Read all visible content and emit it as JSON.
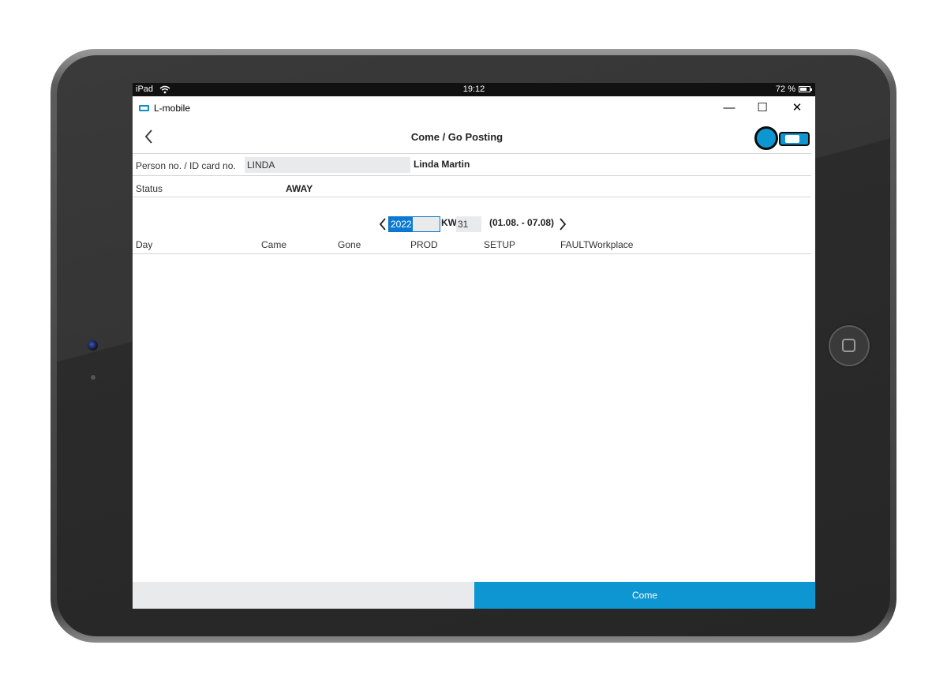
{
  "statusbar": {
    "carrier": "iPad",
    "time": "19:12",
    "battery": "72 %"
  },
  "app": {
    "title": "L-mobile"
  },
  "window_controls": {
    "minimize": "—",
    "maximize": "☐",
    "close": "✕"
  },
  "header": {
    "title": "Come / Go Posting"
  },
  "person": {
    "label": "Person no. / ID card no.",
    "value": "LINDA",
    "name": "Linda Martin"
  },
  "status": {
    "label": "Status",
    "value": "AWAY"
  },
  "week": {
    "year": "2022",
    "kw_label": "KW",
    "kw": "31",
    "range": "(01.08. - 07.08)"
  },
  "table": {
    "columns": [
      "Day",
      "Came",
      "Gone",
      "PROD",
      "SETUP",
      "FAULT",
      "Workplace"
    ]
  },
  "footer": {
    "primary_label": "Come"
  },
  "colors": {
    "accent": "#0e96d3",
    "field_bg": "#e9eaeb",
    "selection": "#0a7ad3"
  },
  "icons": [
    "wifi-icon",
    "battery-icon",
    "app-icon",
    "back-chevron-icon",
    "toggle-switch",
    "prev-week-icon",
    "next-week-icon"
  ]
}
